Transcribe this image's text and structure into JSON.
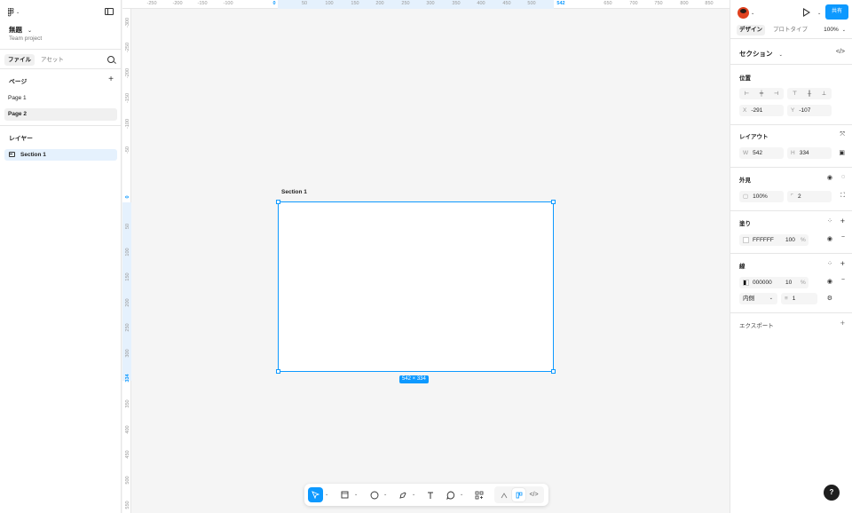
{
  "left_panel": {
    "file_title": "無題",
    "file_subtitle": "Team project",
    "tabs": {
      "file": "ファイル",
      "assets": "アセット"
    },
    "pages_header": "ページ",
    "pages": [
      "Page 1",
      "Page 2"
    ],
    "layers_header": "レイヤー",
    "layers": [
      "Section 1"
    ]
  },
  "canvas": {
    "ruler_top": [
      "-250",
      "-200",
      "-150",
      "-100",
      "0",
      "50",
      "100",
      "150",
      "200",
      "250",
      "300",
      "350",
      "400",
      "450",
      "500",
      "542",
      "650",
      "700",
      "750",
      "800",
      "850"
    ],
    "ruler_left": [
      "-300",
      "-250",
      "-200",
      "-150",
      "-100",
      "-50",
      "0",
      "50",
      "100",
      "150",
      "200",
      "250",
      "300",
      "334",
      "350",
      "400",
      "450",
      "500",
      "550"
    ],
    "section_label": "Section 1",
    "size_badge": "542 × 334"
  },
  "toolbar": {
    "icons": [
      "move-tool",
      "frame-tool",
      "shape-tool",
      "pen-tool",
      "text-tool",
      "comment-tool",
      "actions-tool"
    ]
  },
  "right_panel": {
    "share_label": "共有",
    "tabs": {
      "design": "デザイン",
      "prototype": "プロトタイプ"
    },
    "zoom": "100%",
    "selection_title": "セクション",
    "position": {
      "header": "位置",
      "x_label": "X",
      "x": "-291",
      "y_label": "Y",
      "y": "-107"
    },
    "layout": {
      "header": "レイアウト",
      "w_label": "W",
      "w": "542",
      "h_label": "H",
      "h": "334"
    },
    "appearance": {
      "header": "外見",
      "opacity": "100%",
      "radius": "2"
    },
    "fill": {
      "header": "塗り",
      "hex": "FFFFFF",
      "opacity": "100",
      "pct": "%"
    },
    "stroke": {
      "header": "線",
      "hex": "000000",
      "opacity": "10",
      "pct": "%",
      "position": "内側",
      "weight": "1"
    },
    "export_header": "エクスポート"
  },
  "colors": {
    "accent": "#0d99ff",
    "selection_bg": "#e5f1fd"
  }
}
